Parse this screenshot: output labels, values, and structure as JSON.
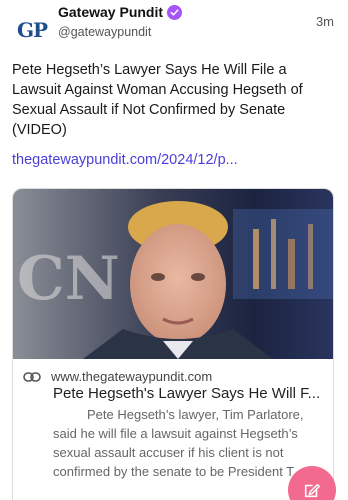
{
  "post": {
    "account_name": "Gateway Pundit",
    "handle": "@gatewaypundit",
    "avatar_text": "GP",
    "time": "3m",
    "text": "Pete Hegseth’s Lawyer Says He Will File a Lawsuit Against Woman Accusing Hegseth of Sexual Assault if Not Confirmed by Senate (VIDEO)",
    "link_text": "thegatewaypundit.com/2024/12/p..."
  },
  "card": {
    "domain": "www.thegatewaypundit.com",
    "title": "Pete Hegseth's Lawyer Says He Will F...",
    "description": "Pete Hegseth’s lawyer, Tim Parlatore, said he will file a lawsuit against Hegseth’s sexual assault accuser if his client is not confirmed by the senate to be President T..."
  },
  "icons": {
    "verified": "verified-badge-icon",
    "link": "link-chain-icon",
    "compose": "compose-pencil-icon"
  },
  "colors": {
    "link": "#4b3fd8",
    "verified": "#a855f7",
    "fab": "#f26a8d",
    "avatar_text": "#1f4e8c"
  }
}
